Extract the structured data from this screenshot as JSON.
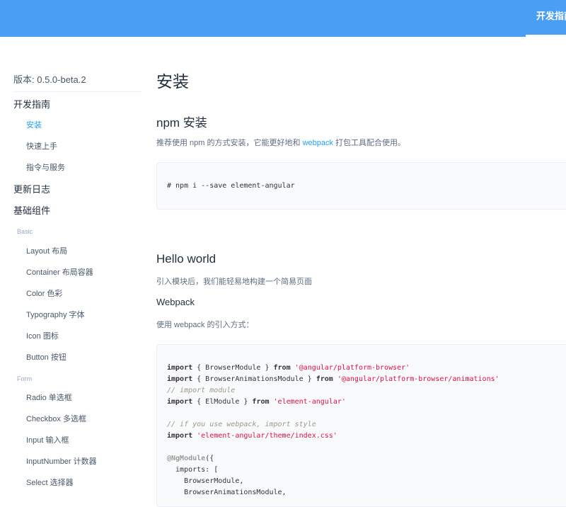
{
  "header": {
    "nav_guide": "开发指南"
  },
  "sidebar": {
    "version": "版本: 0.5.0-beta.2",
    "groups": [
      {
        "title": "开发指南"
      },
      {
        "title": "更新日志"
      },
      {
        "title": "基础组件"
      }
    ],
    "guide_items": [
      {
        "label": "安装"
      },
      {
        "label": "快速上手"
      },
      {
        "label": "指令与服务"
      }
    ],
    "categories": [
      {
        "label": "Basic"
      },
      {
        "label": "Form"
      }
    ],
    "basic_items": [
      {
        "label": "Layout 布局"
      },
      {
        "label": "Container 布局容器"
      },
      {
        "label": "Color 色彩"
      },
      {
        "label": "Typography 字体"
      },
      {
        "label": "Icon 图标"
      },
      {
        "label": "Button 按钮"
      }
    ],
    "form_items": [
      {
        "label": "Radio 单选框"
      },
      {
        "label": "Checkbox 多选框"
      },
      {
        "label": "Input 输入框"
      },
      {
        "label": "InputNumber 计数器"
      },
      {
        "label": "Select 选择器"
      }
    ]
  },
  "content": {
    "title": "安装",
    "npm_heading": "npm 安装",
    "npm_desc_before": "推荐使用 npm 的方式安装，它能更好地和 ",
    "npm_desc_link": "webpack",
    "npm_desc_after": " 打包工具配合使用。",
    "npm_code": "# npm i --save element-angular",
    "hello_heading": "Hello world",
    "hello_desc": "引入模块后，我们能轻易地构建一个简易页面",
    "webpack_heading": "Webpack",
    "webpack_desc": "使用 webpack 的引入方式：",
    "code": {
      "l1_kw1": "import",
      "l1_mid": " { BrowserModule } ",
      "l1_kw2": "from",
      "l1_str": " '@angular/platform-browser'",
      "l2_kw1": "import",
      "l2_mid": " { BrowserAnimationsModule } ",
      "l2_kw2": "from",
      "l2_str": " '@angular/platform-browser/animations'",
      "l3_cm": "// import module",
      "l4_kw1": "import",
      "l4_mid": " { ElModule } ",
      "l4_kw2": "from",
      "l4_str": " 'element-angular'",
      "l6_cm": "// if you use webpack, import style",
      "l7_kw1": "import",
      "l7_str": " 'element-angular/theme/index.css'",
      "l9_deco": "@NgModule",
      "l9_rest": "({",
      "l10": "  imports: [",
      "l11": "    BrowserModule,",
      "l12": "    BrowserAnimationsModule,"
    }
  }
}
